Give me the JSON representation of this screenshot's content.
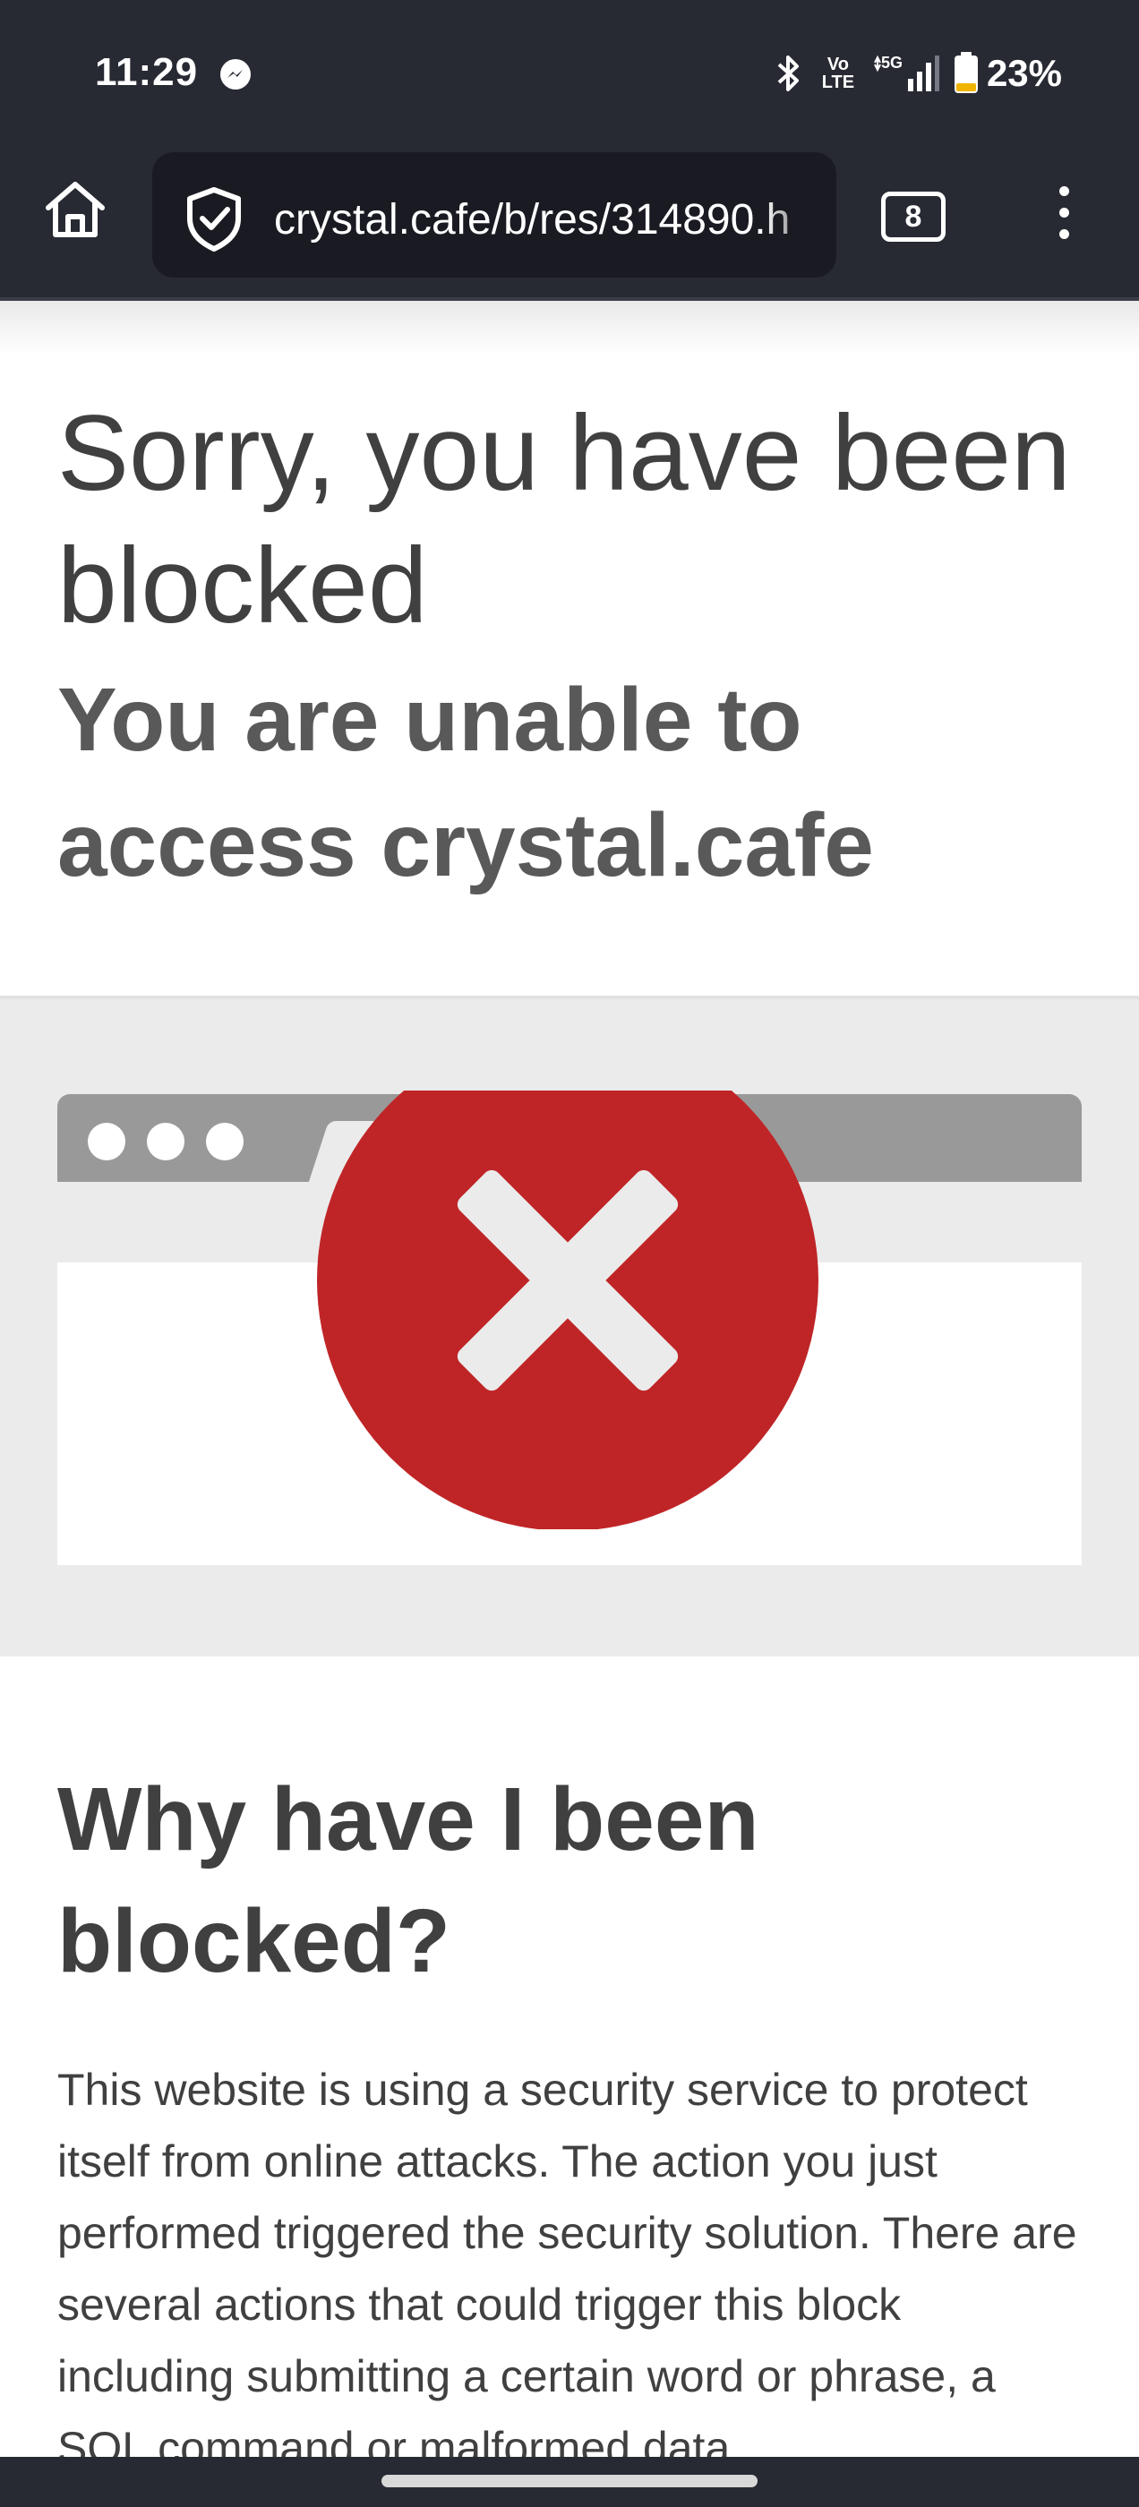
{
  "status_bar": {
    "time": "11:29",
    "notification_icon": "messenger-icon",
    "volte_line1": "Vo",
    "volte_line2": "LTE",
    "network": "5G",
    "battery": "23%"
  },
  "browser": {
    "url": "crystal.cafe/b/res/314890.h",
    "tab_count": "8",
    "home_icon": "home-icon",
    "security_icon": "shield-check-icon",
    "menu_icon": "more-vertical-icon"
  },
  "page": {
    "heading": "Sorry, you have been blocked",
    "subheading": "You are unable to access crystal.cafe",
    "illustration_icon": "error-x-icon",
    "why_heading": "Why have I been blocked?",
    "why_body": "This website is using a security service to protect itself from online attacks. The action you just performed triggered the security solution. There are several actions that could trigger this block including submitting a certain word or phrase, a SQL command or malformed data.",
    "colors": {
      "error_red": "#bf2527",
      "band_gray": "#ebebeb",
      "text_dark": "#404040"
    }
  }
}
